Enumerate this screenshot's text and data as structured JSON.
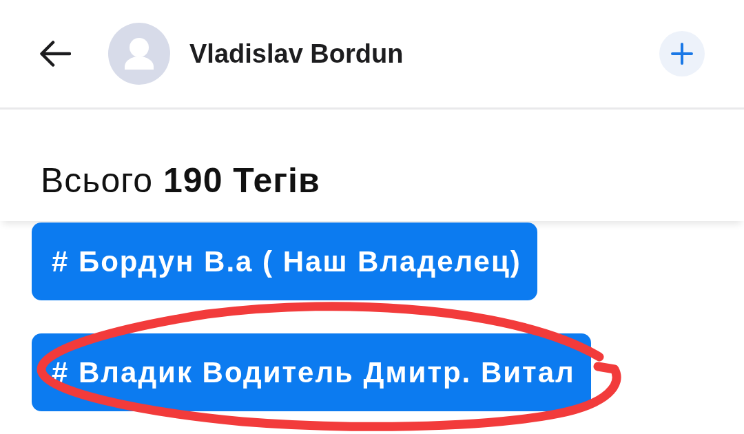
{
  "header": {
    "title": "Vladislav Bordun"
  },
  "summary": {
    "text": "Всього **190 Тегів**"
  },
  "tags": [
    {
      "label": "# Бордун В.а ( Наш Владелец)",
      "circled": false
    },
    {
      "label": "# Владик Водитель Дмитр. Витал",
      "circled": true
    }
  ]
}
